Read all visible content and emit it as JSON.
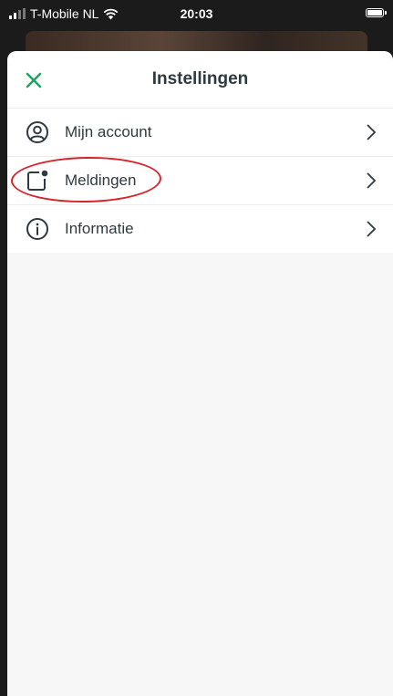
{
  "status_bar": {
    "carrier": "T-Mobile NL",
    "time": "20:03"
  },
  "header": {
    "title": "Instellingen"
  },
  "menu": {
    "items": [
      {
        "label": "Mijn account",
        "icon": "user-circle-icon"
      },
      {
        "label": "Meldingen",
        "icon": "notification-icon"
      },
      {
        "label": "Informatie",
        "icon": "info-icon"
      }
    ]
  },
  "colors": {
    "accent": "#1fa463",
    "highlight": "#d8232a",
    "text": "#2e3a40"
  }
}
